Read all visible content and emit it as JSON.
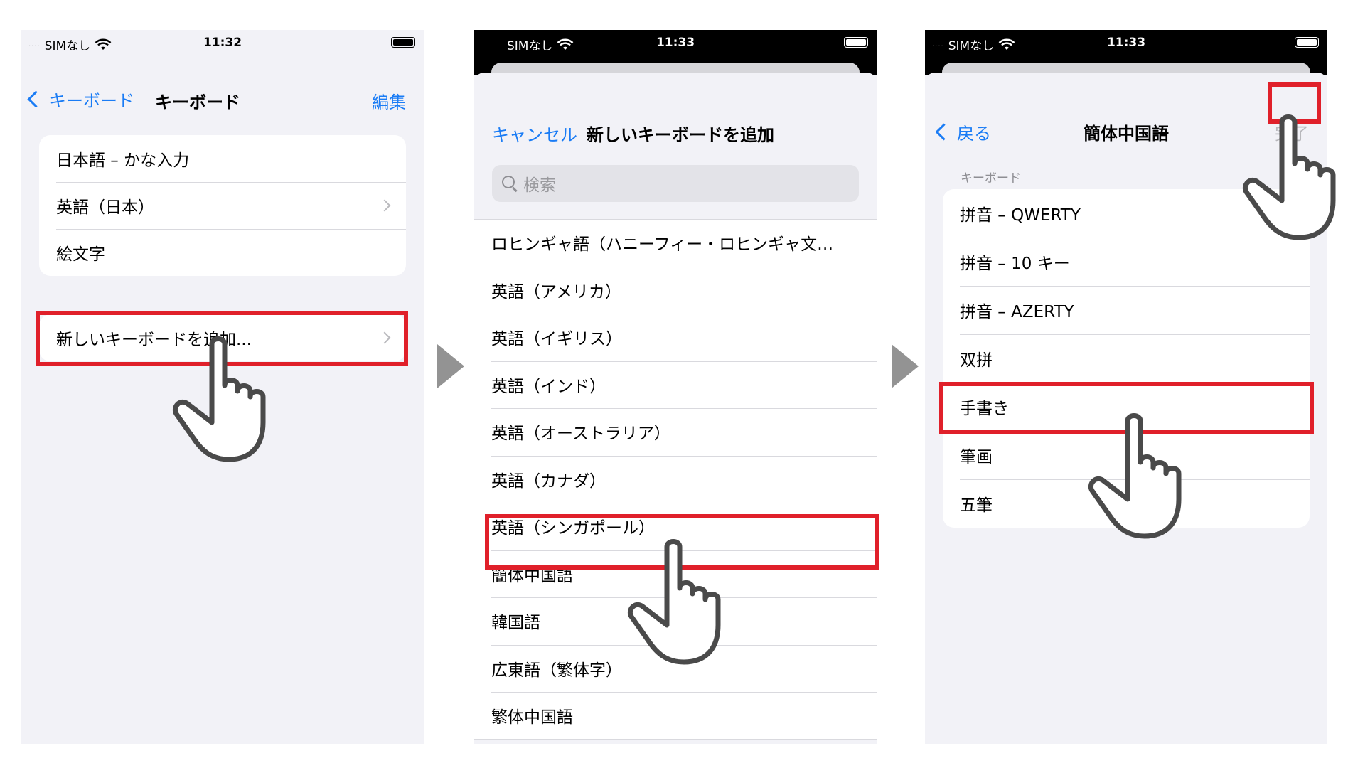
{
  "screen1": {
    "status": {
      "carrier": "SIMなし",
      "time": "11:32"
    },
    "back_label": "キーボード",
    "title": "キーボード",
    "edit_label": "編集",
    "keyboards": [
      {
        "label": "日本語 – かな入力"
      },
      {
        "label": "英語（日本）"
      },
      {
        "label": "絵文字"
      }
    ],
    "add_label": "新しいキーボードを追加..."
  },
  "screen2": {
    "status": {
      "carrier": "SIMなし",
      "time": "11:33"
    },
    "cancel_label": "キャンセル",
    "title": "新しいキーボードを追加",
    "search_placeholder": "検索",
    "languages": [
      "ロヒンギャ語（ハニーフィー・ロヒンギャ文…",
      "英語（アメリカ）",
      "英語（イギリス）",
      "英語（インド）",
      "英語（オーストラリア）",
      "英語（カナダ）",
      "英語（シンガポール）",
      "簡体中国語",
      "韓国語",
      "広東語（繁体字）",
      "繁体中国語"
    ]
  },
  "screen3": {
    "status": {
      "carrier": "SIMなし",
      "time": "11:33"
    },
    "back_label": "戻る",
    "title": "簡体中国語",
    "done_label": "完了",
    "section_label": "キーボード",
    "options": [
      "拼音 – QWERTY",
      "拼音 – 10 キー",
      "拼音 – AZERTY",
      "双拼",
      "手書き",
      "筆画",
      "五筆"
    ]
  },
  "colors": {
    "accent": "#1a7cf5",
    "highlight": "#e0202a",
    "arrow": "#939393",
    "grouped_background": "#f2f2f7"
  },
  "icons": [
    "wifi-icon",
    "battery-icon",
    "chevron-left-icon",
    "chevron-right-icon",
    "search-icon",
    "pointing-hand-icon",
    "next-step-arrow-icon"
  ]
}
